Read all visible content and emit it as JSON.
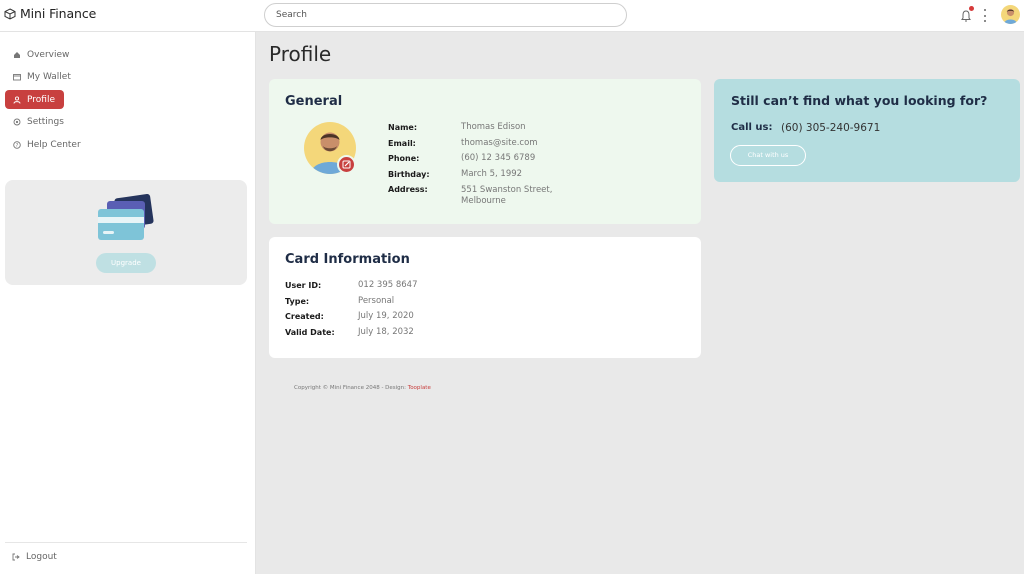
{
  "header": {
    "app_title": "Mini Finance",
    "search_placeholder": "Search",
    "icons": [
      "cube-logo-icon",
      "bell-icon",
      "kebab-icon",
      "user-avatar"
    ]
  },
  "sidebar": {
    "items": [
      {
        "label": "Overview",
        "icon": "home-icon",
        "active": false
      },
      {
        "label": "My Wallet",
        "icon": "wallet-icon",
        "active": false
      },
      {
        "label": "Profile",
        "icon": "person-icon",
        "active": true
      },
      {
        "label": "Settings",
        "icon": "gear-icon",
        "active": false
      },
      {
        "label": "Help Center",
        "icon": "help-icon",
        "active": false
      }
    ],
    "upgrade_label": "Upgrade",
    "logout_label": "Logout"
  },
  "main": {
    "page_title": "Profile",
    "general": {
      "title": "General",
      "fields": [
        {
          "label": "Name:",
          "value": "Thomas Edison"
        },
        {
          "label": "Email:",
          "value": "thomas@site.com"
        },
        {
          "label": "Phone:",
          "value": "(60) 12 345 6789"
        },
        {
          "label": "Birthday:",
          "value": "March 5, 1992"
        },
        {
          "label": "Address:",
          "value_line1": "551 Swanston Street,",
          "value_line2": "Melbourne"
        }
      ]
    },
    "card_info": {
      "title": "Card Information",
      "fields": [
        {
          "label": "User ID:",
          "value": "012 395 8647"
        },
        {
          "label": "Type:",
          "value": "Personal"
        },
        {
          "label": "Created:",
          "value": "July 19, 2020"
        },
        {
          "label": "Valid Date:",
          "value": "July 18, 2032"
        }
      ]
    },
    "help": {
      "title": "Still can’t find what you looking for?",
      "call_label": "Call us:",
      "call_value": "(60) 305-240-9671",
      "chat_button": "Chat with us"
    },
    "footer": {
      "text": "Copyright © Mini Finance 2048 - Design: ",
      "link": "Tooplate"
    }
  },
  "colors": {
    "accent_red": "#c8403f",
    "general_bg": "#eef8ee",
    "help_bg": "#b5dde0",
    "heading_navy": "#1f2d46"
  }
}
